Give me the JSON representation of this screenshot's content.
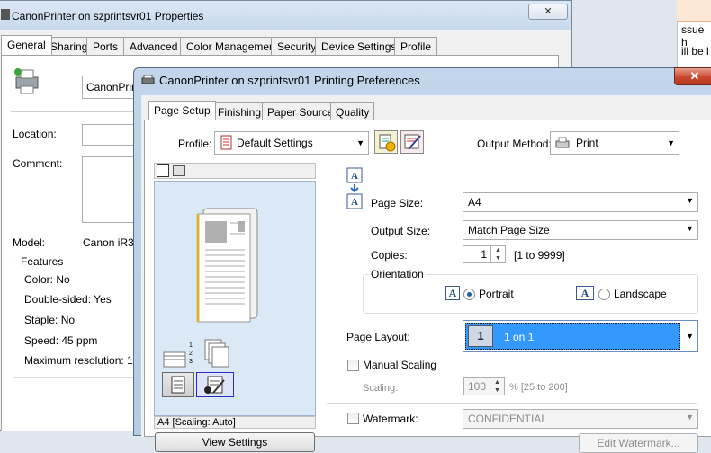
{
  "properties_window": {
    "title": "CanonPrinter on szprintsvr01 Properties",
    "tabs": [
      "General",
      "Sharing",
      "Ports",
      "Advanced",
      "Color Management",
      "Security",
      "Device Settings",
      "Profile"
    ],
    "printer_name_value": "CanonPrin",
    "location_label": "Location:",
    "comment_label": "Comment:",
    "model_label": "Model:",
    "model_value": "Canon iR3:",
    "features_title": "Features",
    "features": [
      "Color: No",
      "Double-sided: Yes",
      "Staple: No",
      "Speed: 45 ppm",
      "Maximum resolution: 1"
    ]
  },
  "background_window": {
    "text_lines": [
      "ssue h",
      "ill be l"
    ]
  },
  "preferences_window": {
    "title": "CanonPrinter on szprintsvr01 Printing Preferences",
    "close_glyph": "✕",
    "tabs": [
      "Page Setup",
      "Finishing",
      "Paper Source",
      "Quality"
    ],
    "profile_label": "Profile:",
    "profile_value": "Default Settings",
    "output_method_label": "Output Method:",
    "output_method_value": "Print",
    "page_size_label": "Page Size:",
    "page_size_value": "A4",
    "output_size_label": "Output Size:",
    "output_size_value": "Match Page Size",
    "copies_label": "Copies:",
    "copies_value": "1",
    "copies_range": "[1 to 9999]",
    "orientation_title": "Orientation",
    "portrait_label": "Portrait",
    "landscape_label": "Landscape",
    "page_layout_label": "Page Layout:",
    "page_layout_icon_text": "1",
    "page_layout_value": "1 on 1",
    "manual_scaling_label": "Manual Scaling",
    "scaling_label": "Scaling:",
    "scaling_value": "100",
    "scaling_range": "% [25 to 200]",
    "watermark_label": "Watermark:",
    "watermark_value": "CONFIDENTIAL",
    "edit_watermark_label": "Edit Watermark...",
    "preview_caption": "A4 [Scaling: Auto]",
    "view_settings_label": "View Settings"
  },
  "colors": {
    "selection_blue": "#3399ff",
    "title_gradient": "#c2d5ea"
  }
}
